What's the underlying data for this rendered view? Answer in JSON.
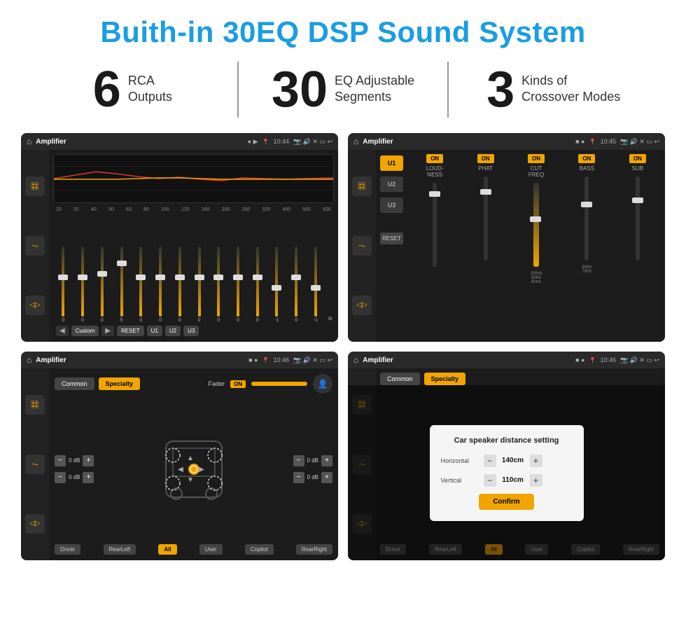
{
  "page": {
    "title": "Buith-in 30EQ DSP Sound System",
    "bg_color": "#ffffff"
  },
  "stats": [
    {
      "number": "6",
      "text": "RCA\nOutputs"
    },
    {
      "number": "30",
      "text": "EQ Adjustable\nSegments"
    },
    {
      "number": "3",
      "text": "Kinds of\nCrossover Modes"
    }
  ],
  "screens": [
    {
      "id": "screen1",
      "topbar": {
        "time": "10:44",
        "title": "Amplifier"
      },
      "type": "eq",
      "freq_labels": [
        "25",
        "32",
        "40",
        "50",
        "63",
        "80",
        "100",
        "125",
        "160",
        "200",
        "250",
        "320",
        "400",
        "500",
        "630"
      ],
      "slider_values": [
        "0",
        "0",
        "0",
        "5",
        "0",
        "0",
        "0",
        "0",
        "0",
        "0",
        "0",
        "-1",
        "0",
        "-1"
      ],
      "buttons": [
        "Custom",
        "RESET",
        "U1",
        "U2",
        "U3"
      ]
    },
    {
      "id": "screen2",
      "topbar": {
        "time": "10:45",
        "title": "Amplifier"
      },
      "type": "crossover",
      "u_buttons": [
        "U1",
        "U2",
        "U3"
      ],
      "channels": [
        "LOUDNESS",
        "PHAT",
        "CUT FREQ",
        "BASS",
        "SUB"
      ],
      "on_states": [
        true,
        true,
        true,
        true,
        true
      ]
    },
    {
      "id": "screen3",
      "topbar": {
        "time": "10:46",
        "title": "Amplifier"
      },
      "type": "fader",
      "tabs": [
        "Common",
        "Specialty"
      ],
      "active_tab": "Specialty",
      "fader_label": "Fader",
      "fader_on": "ON",
      "db_values": [
        "0 dB",
        "0 dB",
        "0 dB",
        "0 dB"
      ],
      "bottom_buttons": [
        "Driver",
        "RearLeft",
        "All",
        "User",
        "Copilot",
        "RearRight"
      ]
    },
    {
      "id": "screen4",
      "topbar": {
        "time": "10:46",
        "title": "Amplifier"
      },
      "type": "distance",
      "dialog": {
        "title": "Car speaker distance setting",
        "horizontal_label": "Horizontal",
        "horizontal_value": "140cm",
        "vertical_label": "Vertical",
        "vertical_value": "110cm",
        "confirm_label": "Confirm"
      },
      "bottom_buttons": [
        "Driver",
        "RearLeft",
        "All",
        "User",
        "Copilot",
        "RearRight"
      ]
    }
  ]
}
